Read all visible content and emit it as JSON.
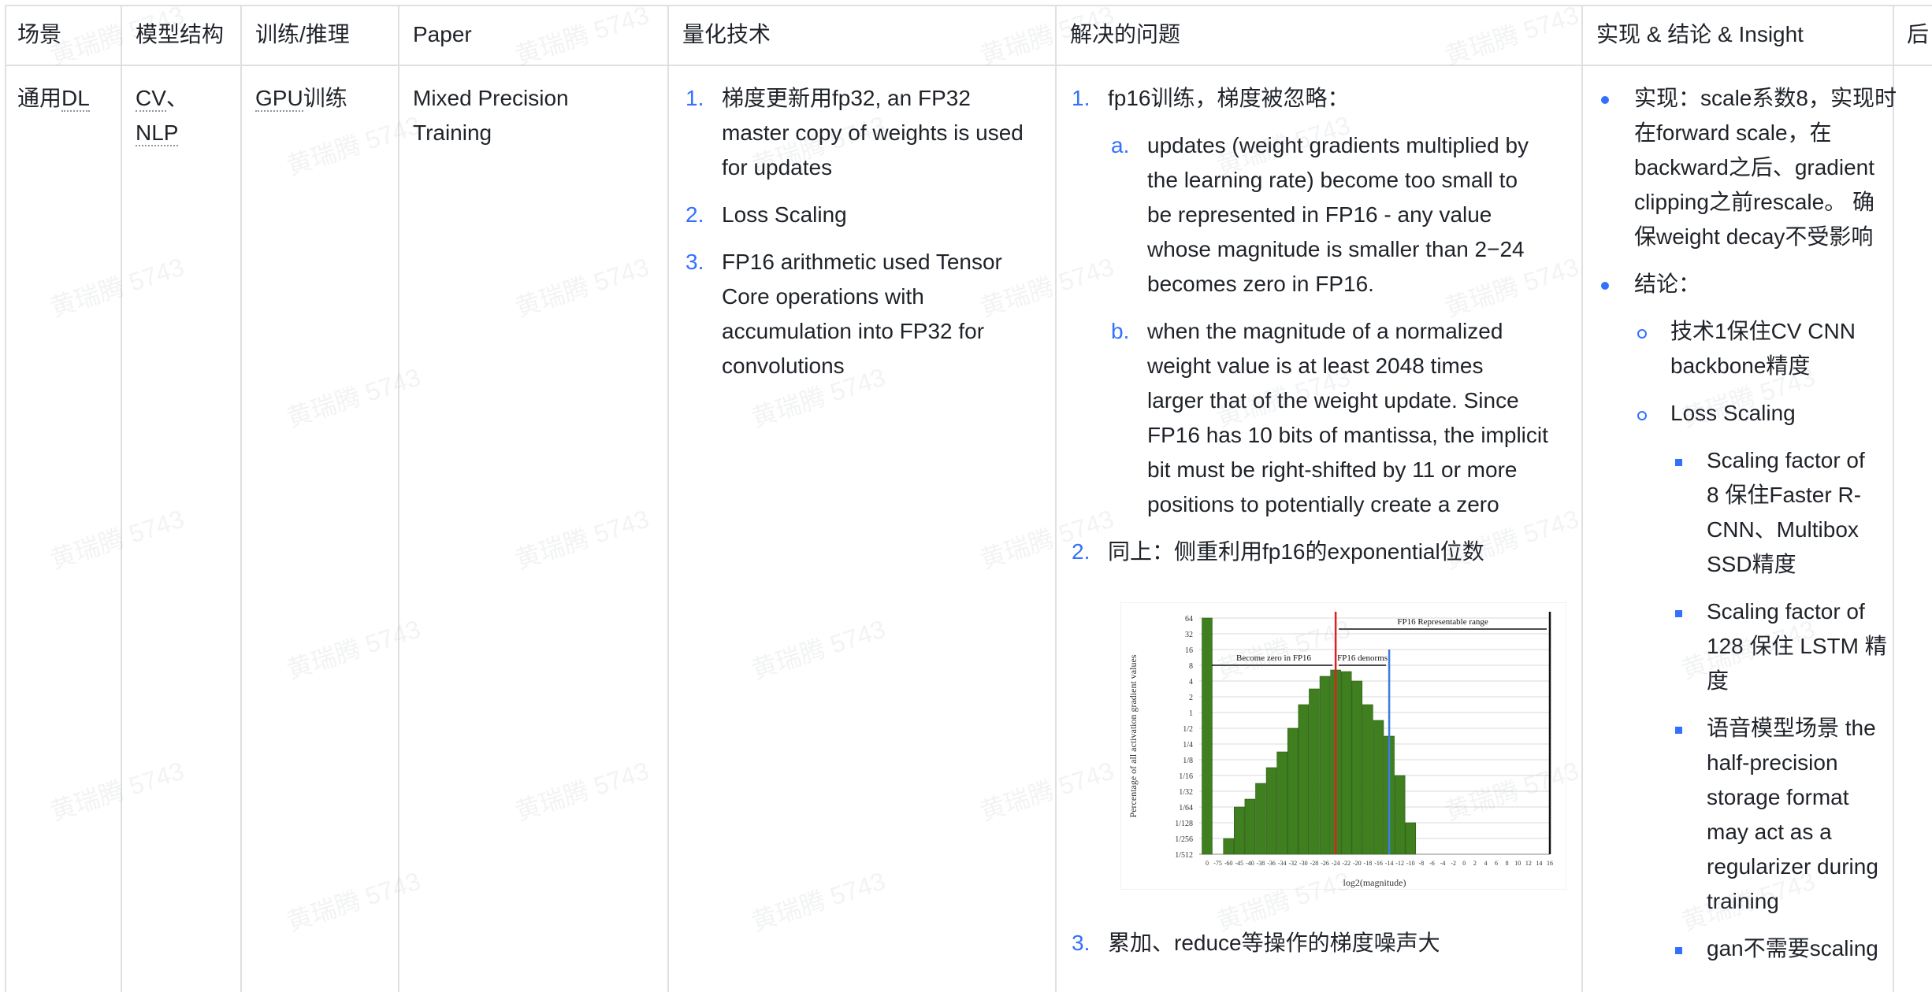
{
  "headers": [
    "场景",
    "模型结构",
    "训练/推理",
    "Paper",
    "量化技术",
    "解决的问题",
    "实现 & 结论 & Insight"
  ],
  "row": {
    "scene": [
      "通用",
      "DL"
    ],
    "model": [
      "CV",
      "、",
      "NLP"
    ],
    "train_infer": [
      "GPU",
      "训练"
    ],
    "paper": [
      "Mixed Precision",
      "Training"
    ],
    "tech": [
      {
        "num": "1.",
        "lines": [
          "梯度更新用fp32, an FP32",
          "master copy of weights is used",
          "for updates"
        ]
      },
      {
        "num": "2.",
        "lines": [
          "Loss Scaling"
        ]
      },
      {
        "num": "3.",
        "lines": [
          "FP16 arithmetic used Tensor",
          "Core operations with",
          "accumulation into FP32 for",
          "convolutions"
        ]
      }
    ],
    "problems": {
      "item1": "fp16训练，梯度被忽略：",
      "item1_num": "1.",
      "a_num": "a.",
      "a_lines": [
        "updates (weight gradients multiplied by",
        "the learning rate) become too small to",
        "be represented in FP16 - any value",
        "whose magnitude is smaller than 2−24",
        "becomes zero in FP16."
      ],
      "b_num": "b.",
      "b_lines": [
        "when the magnitude of a normalized",
        "weight value is at least 2048 times",
        "larger that of the weight update. Since",
        "FP16 has 10 bits of mantissa, the implicit",
        "bit must be right-shifted by 11 or more",
        "positions to potentially create a zero"
      ],
      "item2_num": "2.",
      "item2": "同上：侧重利用fp16的exponential位数",
      "item3_num": "3.",
      "item3": "累加、reduce等操作的梯度噪声大"
    },
    "insight": {
      "impl_lines": [
        "实现：scale系数8，实现时",
        "在forward scale，在",
        "backward之后、gradient",
        "clipping之前rescale。 确",
        "保weight decay不受影响"
      ],
      "conclusion": "结论：",
      "c1_lines": [
        "技术1保住CV CNN",
        "backbone精度"
      ],
      "c2": "Loss Scaling",
      "s1_lines": [
        "Scaling factor of",
        "8 保住Faster R-",
        "CNN、Multibox",
        "SSD精度"
      ],
      "s2_lines": [
        "Scaling factor of",
        "128 保住 LSTM 精",
        "度"
      ],
      "s3_lines": [
        "语音模型场景 the",
        "half-precision",
        "storage format",
        "may act as a",
        "regularizer during",
        "training"
      ],
      "s4": "gan不需要scaling"
    }
  },
  "watermark": "黄瑞腾 5743",
  "colors": {
    "accent": "#3370ff",
    "bar_green": "#3f7f1f",
    "red_line": "#e02020",
    "blue_line": "#3b7de0",
    "border": "#dee0e3"
  },
  "chart_data": {
    "type": "bar",
    "ylabel": "Percentage of all activation gradient values",
    "xlabel": "log2(magnitude)",
    "y_ticks": [
      "64",
      "32",
      "16",
      "8",
      "4",
      "2",
      "1",
      "1/2",
      "1/4",
      "1/8",
      "1/16",
      "1/32",
      "1/64",
      "1/128",
      "1/256",
      "1/512"
    ],
    "x_ticks": [
      "0",
      "-75",
      "-60",
      "-45",
      "-40",
      "-38",
      "-36",
      "-34",
      "-32",
      "-30",
      "-28",
      "-26",
      "-24",
      "-22",
      "-20",
      "-18",
      "-16",
      "-14",
      "-12",
      "-10",
      "-8",
      "-6",
      "-4",
      "-2",
      "0",
      "2",
      "4",
      "6",
      "8",
      "10",
      "12",
      "14",
      "16"
    ],
    "categories": [
      "0",
      "-60",
      "-45",
      "-40",
      "-38",
      "-36",
      "-34",
      "-32",
      "-30",
      "-28",
      "-26",
      "-24",
      "-22",
      "-20",
      "-18",
      "-16",
      "-14",
      "-12",
      "-10"
    ],
    "values_log2": [
      6,
      -8,
      -6,
      -5.5,
      -4.5,
      -3.5,
      -2.5,
      -1,
      0.5,
      1.5,
      2.3,
      2.7,
      2.6,
      2,
      0.5,
      -0.5,
      -1.5,
      -4,
      -7
    ],
    "annotations": [
      "FP16 Representable range",
      "Become zero in FP16",
      "FP16 denorms"
    ],
    "markers": {
      "red_at": "-24",
      "blue_at": "-14",
      "black_at": "16"
    }
  }
}
